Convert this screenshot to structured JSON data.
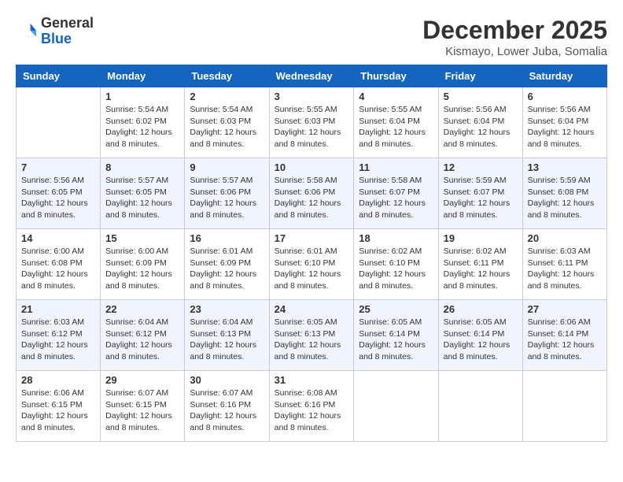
{
  "logo": {
    "general": "General",
    "blue": "Blue"
  },
  "title": "December 2025",
  "location": "Kismayo, Lower Juba, Somalia",
  "headers": [
    "Sunday",
    "Monday",
    "Tuesday",
    "Wednesday",
    "Thursday",
    "Friday",
    "Saturday"
  ],
  "weeks": [
    [
      {
        "day": "",
        "sunrise": "",
        "sunset": "",
        "daylight": ""
      },
      {
        "day": "1",
        "sunrise": "Sunrise: 5:54 AM",
        "sunset": "Sunset: 6:02 PM",
        "daylight": "Daylight: 12 hours and 8 minutes."
      },
      {
        "day": "2",
        "sunrise": "Sunrise: 5:54 AM",
        "sunset": "Sunset: 6:03 PM",
        "daylight": "Daylight: 12 hours and 8 minutes."
      },
      {
        "day": "3",
        "sunrise": "Sunrise: 5:55 AM",
        "sunset": "Sunset: 6:03 PM",
        "daylight": "Daylight: 12 hours and 8 minutes."
      },
      {
        "day": "4",
        "sunrise": "Sunrise: 5:55 AM",
        "sunset": "Sunset: 6:04 PM",
        "daylight": "Daylight: 12 hours and 8 minutes."
      },
      {
        "day": "5",
        "sunrise": "Sunrise: 5:56 AM",
        "sunset": "Sunset: 6:04 PM",
        "daylight": "Daylight: 12 hours and 8 minutes."
      },
      {
        "day": "6",
        "sunrise": "Sunrise: 5:56 AM",
        "sunset": "Sunset: 6:04 PM",
        "daylight": "Daylight: 12 hours and 8 minutes."
      }
    ],
    [
      {
        "day": "7",
        "sunrise": "Sunrise: 5:56 AM",
        "sunset": "Sunset: 6:05 PM",
        "daylight": "Daylight: 12 hours and 8 minutes."
      },
      {
        "day": "8",
        "sunrise": "Sunrise: 5:57 AM",
        "sunset": "Sunset: 6:05 PM",
        "daylight": "Daylight: 12 hours and 8 minutes."
      },
      {
        "day": "9",
        "sunrise": "Sunrise: 5:57 AM",
        "sunset": "Sunset: 6:06 PM",
        "daylight": "Daylight: 12 hours and 8 minutes."
      },
      {
        "day": "10",
        "sunrise": "Sunrise: 5:58 AM",
        "sunset": "Sunset: 6:06 PM",
        "daylight": "Daylight: 12 hours and 8 minutes."
      },
      {
        "day": "11",
        "sunrise": "Sunrise: 5:58 AM",
        "sunset": "Sunset: 6:07 PM",
        "daylight": "Daylight: 12 hours and 8 minutes."
      },
      {
        "day": "12",
        "sunrise": "Sunrise: 5:59 AM",
        "sunset": "Sunset: 6:07 PM",
        "daylight": "Daylight: 12 hours and 8 minutes."
      },
      {
        "day": "13",
        "sunrise": "Sunrise: 5:59 AM",
        "sunset": "Sunset: 6:08 PM",
        "daylight": "Daylight: 12 hours and 8 minutes."
      }
    ],
    [
      {
        "day": "14",
        "sunrise": "Sunrise: 6:00 AM",
        "sunset": "Sunset: 6:08 PM",
        "daylight": "Daylight: 12 hours and 8 minutes."
      },
      {
        "day": "15",
        "sunrise": "Sunrise: 6:00 AM",
        "sunset": "Sunset: 6:09 PM",
        "daylight": "Daylight: 12 hours and 8 minutes."
      },
      {
        "day": "16",
        "sunrise": "Sunrise: 6:01 AM",
        "sunset": "Sunset: 6:09 PM",
        "daylight": "Daylight: 12 hours and 8 minutes."
      },
      {
        "day": "17",
        "sunrise": "Sunrise: 6:01 AM",
        "sunset": "Sunset: 6:10 PM",
        "daylight": "Daylight: 12 hours and 8 minutes."
      },
      {
        "day": "18",
        "sunrise": "Sunrise: 6:02 AM",
        "sunset": "Sunset: 6:10 PM",
        "daylight": "Daylight: 12 hours and 8 minutes."
      },
      {
        "day": "19",
        "sunrise": "Sunrise: 6:02 AM",
        "sunset": "Sunset: 6:11 PM",
        "daylight": "Daylight: 12 hours and 8 minutes."
      },
      {
        "day": "20",
        "sunrise": "Sunrise: 6:03 AM",
        "sunset": "Sunset: 6:11 PM",
        "daylight": "Daylight: 12 hours and 8 minutes."
      }
    ],
    [
      {
        "day": "21",
        "sunrise": "Sunrise: 6:03 AM",
        "sunset": "Sunset: 6:12 PM",
        "daylight": "Daylight: 12 hours and 8 minutes."
      },
      {
        "day": "22",
        "sunrise": "Sunrise: 6:04 AM",
        "sunset": "Sunset: 6:12 PM",
        "daylight": "Daylight: 12 hours and 8 minutes."
      },
      {
        "day": "23",
        "sunrise": "Sunrise: 6:04 AM",
        "sunset": "Sunset: 6:13 PM",
        "daylight": "Daylight: 12 hours and 8 minutes."
      },
      {
        "day": "24",
        "sunrise": "Sunrise: 6:05 AM",
        "sunset": "Sunset: 6:13 PM",
        "daylight": "Daylight: 12 hours and 8 minutes."
      },
      {
        "day": "25",
        "sunrise": "Sunrise: 6:05 AM",
        "sunset": "Sunset: 6:14 PM",
        "daylight": "Daylight: 12 hours and 8 minutes."
      },
      {
        "day": "26",
        "sunrise": "Sunrise: 6:05 AM",
        "sunset": "Sunset: 6:14 PM",
        "daylight": "Daylight: 12 hours and 8 minutes."
      },
      {
        "day": "27",
        "sunrise": "Sunrise: 6:06 AM",
        "sunset": "Sunset: 6:14 PM",
        "daylight": "Daylight: 12 hours and 8 minutes."
      }
    ],
    [
      {
        "day": "28",
        "sunrise": "Sunrise: 6:06 AM",
        "sunset": "Sunset: 6:15 PM",
        "daylight": "Daylight: 12 hours and 8 minutes."
      },
      {
        "day": "29",
        "sunrise": "Sunrise: 6:07 AM",
        "sunset": "Sunset: 6:15 PM",
        "daylight": "Daylight: 12 hours and 8 minutes."
      },
      {
        "day": "30",
        "sunrise": "Sunrise: 6:07 AM",
        "sunset": "Sunset: 6:16 PM",
        "daylight": "Daylight: 12 hours and 8 minutes."
      },
      {
        "day": "31",
        "sunrise": "Sunrise: 6:08 AM",
        "sunset": "Sunset: 6:16 PM",
        "daylight": "Daylight: 12 hours and 8 minutes."
      },
      {
        "day": "",
        "sunrise": "",
        "sunset": "",
        "daylight": ""
      },
      {
        "day": "",
        "sunrise": "",
        "sunset": "",
        "daylight": ""
      },
      {
        "day": "",
        "sunrise": "",
        "sunset": "",
        "daylight": ""
      }
    ]
  ]
}
